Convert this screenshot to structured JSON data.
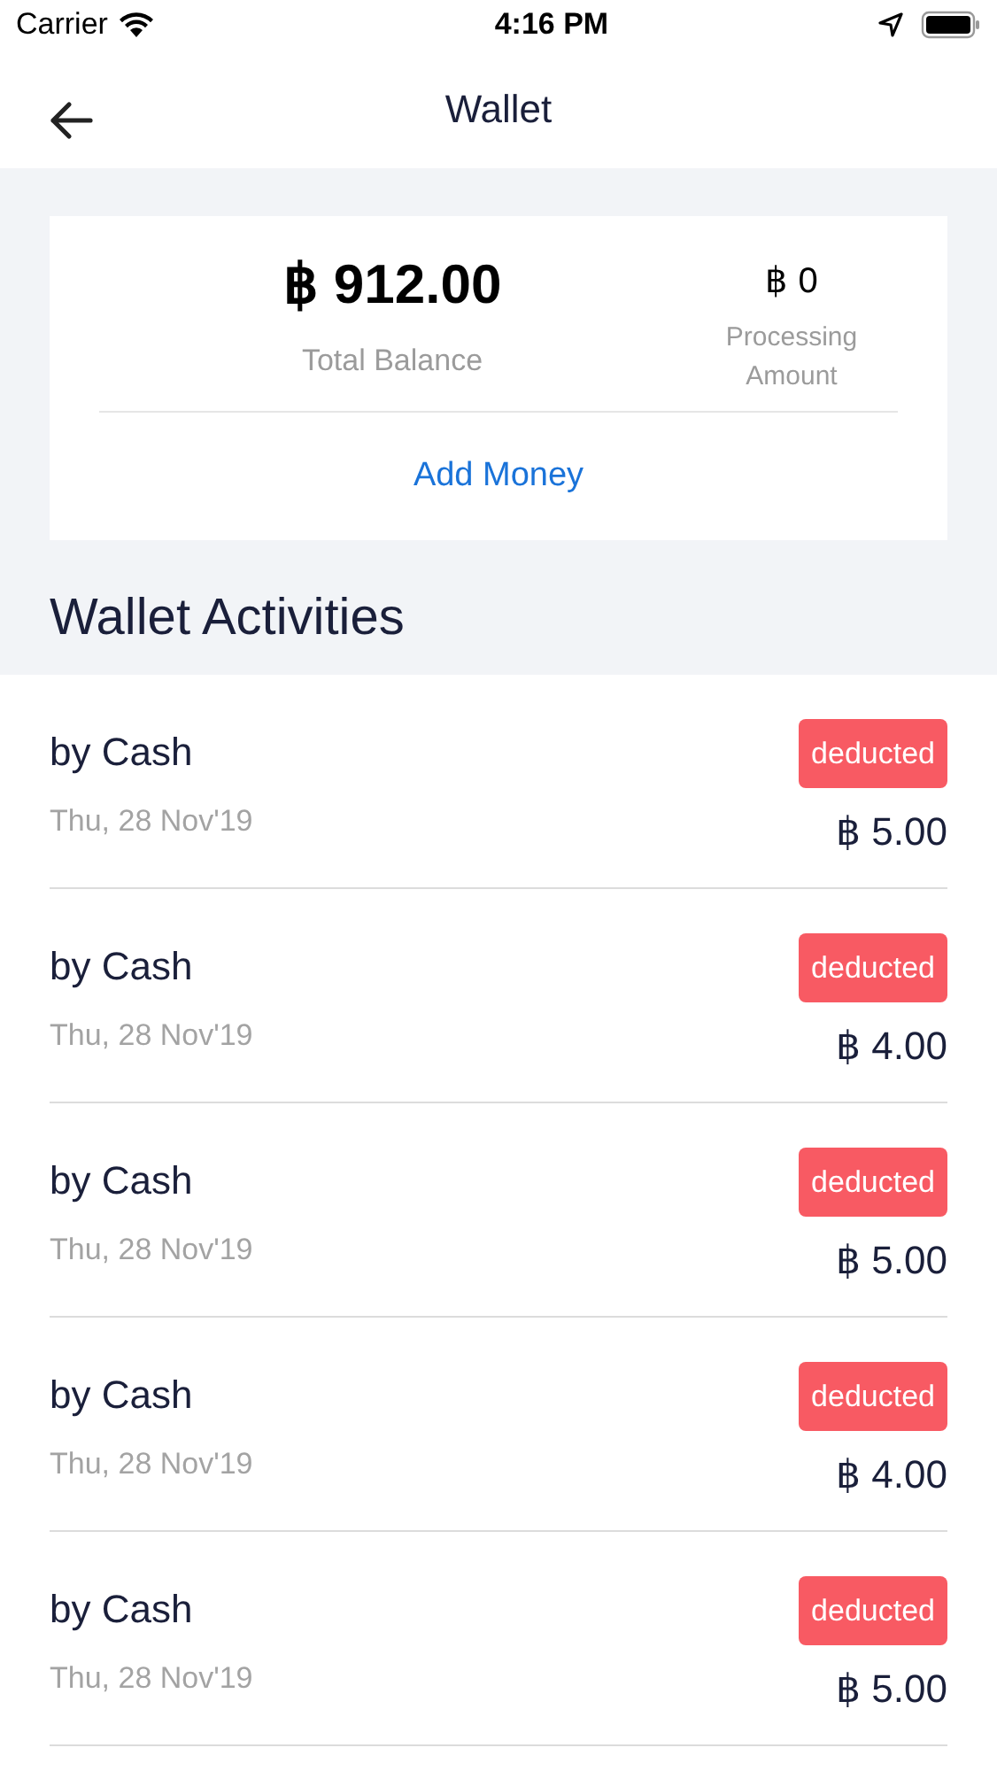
{
  "status_bar": {
    "carrier": "Carrier",
    "time": "4:16 PM"
  },
  "header": {
    "title": "Wallet"
  },
  "balance_card": {
    "total_amount": "฿ 912.00",
    "total_label": "Total Balance",
    "processing_amount": "฿ 0",
    "processing_label": "Processing Amount",
    "action": "Add Money"
  },
  "section_title": "Wallet Activities",
  "activities": [
    {
      "title": "by Cash",
      "date": "Thu, 28 Nov'19",
      "badge": "deducted",
      "amount": "฿ 5.00"
    },
    {
      "title": "by Cash",
      "date": "Thu, 28 Nov'19",
      "badge": "deducted",
      "amount": "฿ 4.00"
    },
    {
      "title": "by Cash",
      "date": "Thu, 28 Nov'19",
      "badge": "deducted",
      "amount": "฿ 5.00"
    },
    {
      "title": "by Cash",
      "date": "Thu, 28 Nov'19",
      "badge": "deducted",
      "amount": "฿ 4.00"
    },
    {
      "title": "by Cash",
      "date": "Thu, 28 Nov'19",
      "badge": "deducted",
      "amount": "฿ 5.00"
    }
  ]
}
